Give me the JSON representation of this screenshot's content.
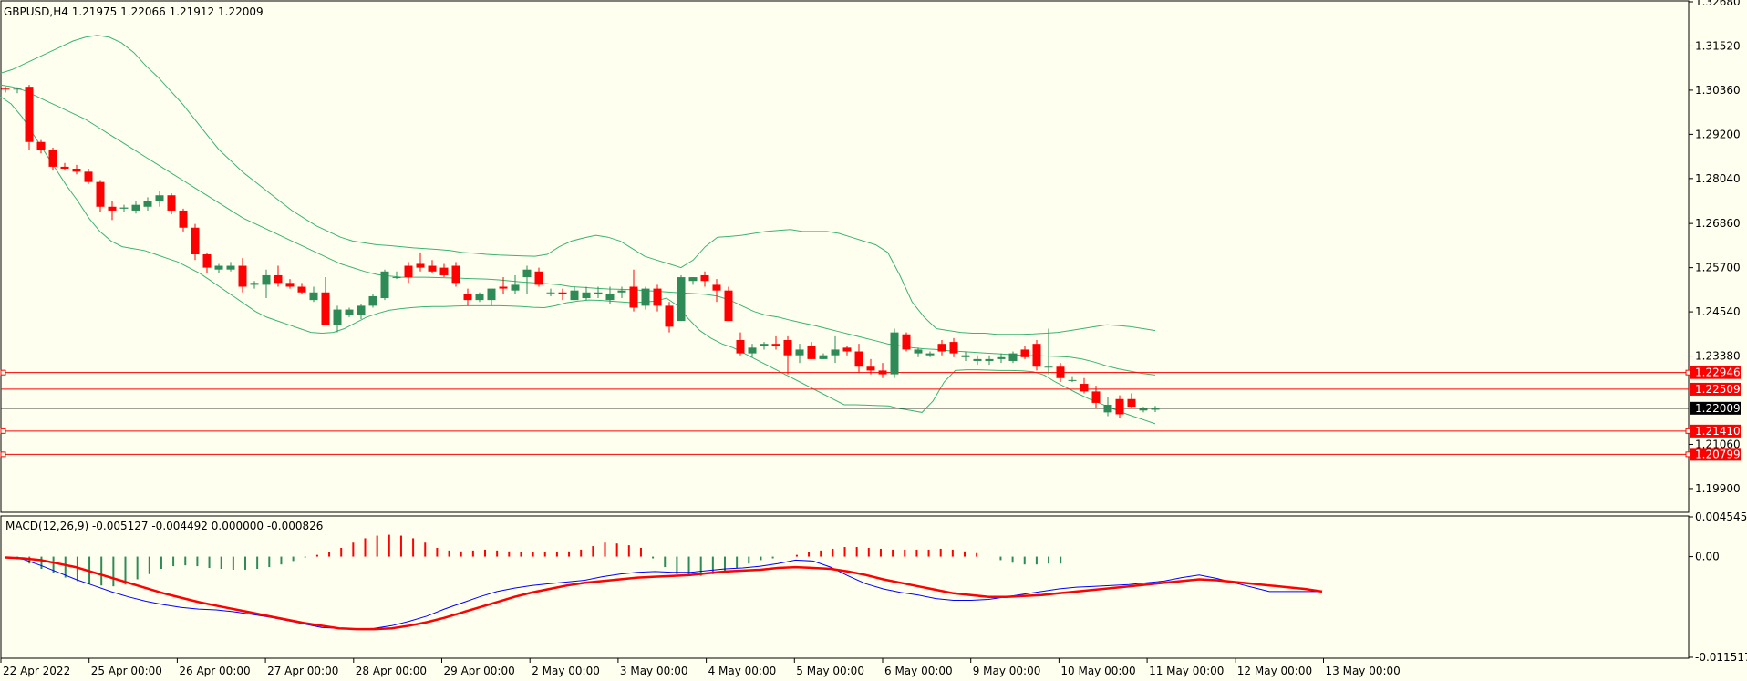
{
  "symbol_header": "GBPUSD,H4  1.21975 1.22066 1.21912 1.22009",
  "macd_header": "MACD(12,26,9) -0.005127 -0.004492 0.000000 -0.000826",
  "colors": {
    "background": "#fffff0",
    "bull_candle": "#2e8b57",
    "bear_candle": "#ff0000",
    "bollinger": "#3cb371",
    "level_line": "#ff0000",
    "current_price_line": "#000000",
    "macd_main": "#0000ff",
    "macd_signal": "#ff0000"
  },
  "chart_data": [
    {
      "type": "candlestick",
      "title": "GBPUSD,H4",
      "ylim": [
        1.193,
        1.3268
      ],
      "y_ticks": [
        "1.32680",
        "1.31520",
        "1.30360",
        "1.29200",
        "1.28040",
        "1.26860",
        "1.25700",
        "1.24540",
        "1.23380",
        "1.21060",
        "1.19900"
      ],
      "x_tick_labels": [
        "22 Apr 2022",
        "25 Apr 00:00",
        "26 Apr 00:00",
        "27 Apr 00:00",
        "28 Apr 00:00",
        "29 Apr 00:00",
        "2 May 00:00",
        "3 May 00:00",
        "4 May 00:00",
        "5 May 00:00",
        "6 May 00:00",
        "9 May 00:00",
        "10 May 00:00",
        "11 May 00:00",
        "12 May 00:00",
        "13 May 00:00"
      ],
      "candles": [
        [
          1.304,
          1.3045,
          1.303,
          1.3038
        ],
        [
          1.3038,
          1.3044,
          1.3028,
          1.304
        ],
        [
          1.3045,
          1.305,
          1.288,
          1.29
        ],
        [
          1.29,
          1.2905,
          1.287,
          1.288
        ],
        [
          1.288,
          1.2885,
          1.2825,
          1.2835
        ],
        [
          1.2835,
          1.2845,
          1.2825,
          1.283
        ],
        [
          1.283,
          1.284,
          1.2815,
          1.2822
        ],
        [
          1.2822,
          1.283,
          1.279,
          1.2795
        ],
        [
          1.2795,
          1.28,
          1.2715,
          1.273
        ],
        [
          1.273,
          1.2745,
          1.2695,
          1.272
        ],
        [
          1.2725,
          1.2735,
          1.2715,
          1.2728
        ],
        [
          1.272,
          1.2745,
          1.2712,
          1.2735
        ],
        [
          1.273,
          1.2755,
          1.272,
          1.2745
        ],
        [
          1.2745,
          1.277,
          1.273,
          1.276
        ],
        [
          1.276,
          1.2765,
          1.271,
          1.272
        ],
        [
          1.272,
          1.2725,
          1.2665,
          1.2675
        ],
        [
          1.2675,
          1.2685,
          1.259,
          1.2605
        ],
        [
          1.2605,
          1.261,
          1.2555,
          1.257
        ],
        [
          1.2565,
          1.258,
          1.2555,
          1.2575
        ],
        [
          1.2565,
          1.2585,
          1.256,
          1.2575
        ],
        [
          1.2575,
          1.2595,
          1.2505,
          1.252
        ],
        [
          1.2525,
          1.2535,
          1.2515,
          1.253
        ],
        [
          1.2525,
          1.2565,
          1.249,
          1.255
        ],
        [
          1.255,
          1.2575,
          1.252,
          1.253
        ],
        [
          1.253,
          1.254,
          1.2515,
          1.252
        ],
        [
          1.252,
          1.253,
          1.25,
          1.2505
        ],
        [
          1.2485,
          1.252,
          1.248,
          1.2505
        ],
        [
          1.2505,
          1.2545,
          1.2475,
          1.242
        ],
        [
          1.242,
          1.247,
          1.24,
          1.246
        ],
        [
          1.2445,
          1.2465,
          1.244,
          1.246
        ],
        [
          1.2445,
          1.2475,
          1.2435,
          1.247
        ],
        [
          1.247,
          1.25,
          1.2465,
          1.2495
        ],
        [
          1.249,
          1.2565,
          1.2485,
          1.256
        ],
        [
          1.2545,
          1.256,
          1.254,
          1.2545
        ],
        [
          1.2575,
          1.2585,
          1.253,
          1.2545
        ],
        [
          1.258,
          1.261,
          1.256,
          1.257
        ],
        [
          1.2575,
          1.259,
          1.2555,
          1.256
        ],
        [
          1.257,
          1.258,
          1.2545,
          1.255
        ],
        [
          1.2575,
          1.2585,
          1.252,
          1.253
        ],
        [
          1.25,
          1.2515,
          1.247,
          1.2485
        ],
        [
          1.2485,
          1.2505,
          1.248,
          1.25
        ],
        [
          1.2485,
          1.251,
          1.247,
          1.2515
        ],
        [
          1.252,
          1.2545,
          1.25,
          1.2515
        ],
        [
          1.251,
          1.255,
          1.25,
          1.2525
        ],
        [
          1.2545,
          1.2575,
          1.25,
          1.2565
        ],
        [
          1.256,
          1.257,
          1.252,
          1.2525
        ],
        [
          1.2505,
          1.2515,
          1.2495,
          1.2505
        ],
        [
          1.2505,
          1.2515,
          1.2485,
          1.25
        ],
        [
          1.2485,
          1.252,
          1.2485,
          1.251
        ],
        [
          1.249,
          1.252,
          1.2485,
          1.2505
        ],
        [
          1.25,
          1.252,
          1.249,
          1.2505
        ],
        [
          1.2485,
          1.252,
          1.2475,
          1.25
        ],
        [
          1.2505,
          1.252,
          1.249,
          1.251
        ],
        [
          1.252,
          1.2565,
          1.2455,
          1.2465
        ],
        [
          1.247,
          1.252,
          1.246,
          1.2515
        ],
        [
          1.2515,
          1.2525,
          1.2455,
          1.247
        ],
        [
          1.247,
          1.248,
          1.24,
          1.2415
        ],
        [
          1.243,
          1.255,
          1.243,
          1.2545
        ],
        [
          1.2535,
          1.2545,
          1.2525,
          1.2545
        ],
        [
          1.255,
          1.256,
          1.252,
          1.2535
        ],
        [
          1.2525,
          1.254,
          1.248,
          1.251
        ],
        [
          1.251,
          1.252,
          1.243,
          1.243
        ],
        [
          1.238,
          1.24,
          1.234,
          1.2345
        ],
        [
          1.2345,
          1.237,
          1.2335,
          1.236
        ],
        [
          1.2365,
          1.2375,
          1.2355,
          1.237
        ],
        [
          1.237,
          1.239,
          1.2355,
          1.2365
        ],
        [
          1.238,
          1.239,
          1.229,
          1.234
        ],
        [
          1.234,
          1.237,
          1.232,
          1.2355
        ],
        [
          1.2365,
          1.2375,
          1.233,
          1.233
        ],
        [
          1.233,
          1.2345,
          1.233,
          1.234
        ],
        [
          1.234,
          1.239,
          1.232,
          1.2355
        ],
        [
          1.236,
          1.2365,
          1.234,
          1.235
        ],
        [
          1.235,
          1.237,
          1.2295,
          1.231
        ],
        [
          1.231,
          1.233,
          1.229,
          1.23
        ],
        [
          1.23,
          1.232,
          1.228,
          1.229
        ],
        [
          1.229,
          1.241,
          1.228,
          1.24
        ],
        [
          1.2395,
          1.24,
          1.235,
          1.2355
        ],
        [
          1.2345,
          1.236,
          1.2335,
          1.2355
        ],
        [
          1.234,
          1.235,
          1.2335,
          1.2345
        ],
        [
          1.237,
          1.238,
          1.234,
          1.235
        ],
        [
          1.2375,
          1.2385,
          1.2335,
          1.2345
        ],
        [
          1.2335,
          1.235,
          1.2325,
          1.234
        ],
        [
          1.2325,
          1.234,
          1.2315,
          1.233
        ],
        [
          1.2325,
          1.234,
          1.2315,
          1.233
        ],
        [
          1.233,
          1.2345,
          1.232,
          1.2335
        ],
        [
          1.2325,
          1.235,
          1.232,
          1.2345
        ],
        [
          1.2355,
          1.2365,
          1.233,
          1.2335
        ],
        [
          1.237,
          1.238,
          1.23,
          1.231
        ],
        [
          1.231,
          1.241,
          1.229,
          1.231
        ],
        [
          1.231,
          1.232,
          1.227,
          1.228
        ],
        [
          1.2275,
          1.2285,
          1.227,
          1.2275
        ],
        [
          1.2265,
          1.228,
          1.224,
          1.2245
        ],
        [
          1.2245,
          1.226,
          1.22,
          1.2215
        ],
        [
          1.219,
          1.223,
          1.218,
          1.221
        ],
        [
          1.2225,
          1.2235,
          1.2175,
          1.2185
        ],
        [
          1.2225,
          1.224,
          1.22,
          1.2205
        ],
        [
          1.2195,
          1.2205,
          1.219,
          1.22
        ],
        [
          1.2197,
          1.2207,
          1.2191,
          1.2201
        ]
      ],
      "bollinger_upper": [
        1.308,
        1.309,
        1.3105,
        1.312,
        1.3135,
        1.315,
        1.3165,
        1.3175,
        1.318,
        1.3175,
        1.316,
        1.3135,
        1.31,
        1.307,
        1.3035,
        1.3,
        1.296,
        1.292,
        1.288,
        1.285,
        1.282,
        1.2795,
        1.277,
        1.2745,
        1.272,
        1.27,
        1.268,
        1.2665,
        1.265,
        1.264,
        1.2635,
        1.263,
        1.2628,
        1.2625,
        1.2622,
        1.262,
        1.2618,
        1.2615,
        1.261,
        1.2608,
        1.2605,
        1.2603,
        1.2602,
        1.2601,
        1.26,
        1.2605,
        1.2625,
        1.264,
        1.2648,
        1.2655,
        1.265,
        1.264,
        1.262,
        1.26,
        1.259,
        1.258,
        1.257,
        1.259,
        1.2625,
        1.265,
        1.2652,
        1.2655,
        1.266,
        1.2665,
        1.2668,
        1.267,
        1.2665,
        1.2665,
        1.2665,
        1.266,
        1.265,
        1.264,
        1.263,
        1.261,
        1.255,
        1.248,
        1.244,
        1.241,
        1.2405,
        1.24,
        1.2398,
        1.2398,
        1.2395,
        1.2395,
        1.2395,
        1.2396,
        1.2398,
        1.24,
        1.2405,
        1.241,
        1.2415,
        1.242,
        1.2418,
        1.2415,
        1.241,
        1.2405
      ],
      "bollinger_middle": [
        1.305,
        1.3045,
        1.3035,
        1.302,
        1.3005,
        1.299,
        1.2975,
        1.296,
        1.294,
        1.292,
        1.29,
        1.288,
        1.286,
        1.284,
        1.282,
        1.28,
        1.278,
        1.276,
        1.274,
        1.272,
        1.27,
        1.2685,
        1.267,
        1.2655,
        1.264,
        1.2625,
        1.261,
        1.2595,
        1.258,
        1.257,
        1.256,
        1.2552,
        1.2548,
        1.2545,
        1.2545,
        1.2545,
        1.2544,
        1.2543,
        1.2542,
        1.2541,
        1.254,
        1.2538,
        1.2535,
        1.2532,
        1.253,
        1.2528,
        1.2525,
        1.252,
        1.2518,
        1.2516,
        1.2514,
        1.2513,
        1.2512,
        1.251,
        1.2508,
        1.2506,
        1.2504,
        1.2502,
        1.25,
        1.2495,
        1.2485,
        1.247,
        1.2455,
        1.2445,
        1.244,
        1.2432,
        1.2425,
        1.2418,
        1.241,
        1.2402,
        1.2394,
        1.2386,
        1.2378,
        1.237,
        1.2365,
        1.236,
        1.2357,
        1.2355,
        1.2352,
        1.235,
        1.2348,
        1.2346,
        1.2344,
        1.2342,
        1.234,
        1.2339,
        1.2338,
        1.2337,
        1.2335,
        1.233,
        1.2322,
        1.2312,
        1.2304,
        1.2298,
        1.2292,
        1.2288
      ],
      "bollinger_lower": [
        1.302,
        1.3,
        1.2965,
        1.292,
        1.2875,
        1.283,
        1.2785,
        1.2745,
        1.27,
        1.2665,
        1.264,
        1.2625,
        1.262,
        1.2615,
        1.2605,
        1.2595,
        1.2585,
        1.257,
        1.2555,
        1.2535,
        1.2515,
        1.2495,
        1.2475,
        1.2455,
        1.244,
        1.243,
        1.242,
        1.241,
        1.24,
        1.2398,
        1.24,
        1.241,
        1.2425,
        1.244,
        1.245,
        1.2458,
        1.2462,
        1.2465,
        1.2467,
        1.2468,
        1.2468,
        1.2469,
        1.247,
        1.247,
        1.247,
        1.247,
        1.2469,
        1.2468,
        1.2466,
        1.2465,
        1.247,
        1.2478,
        1.2482,
        1.2485,
        1.2484,
        1.2482,
        1.248,
        1.2478,
        1.248,
        1.2482,
        1.249,
        1.247,
        1.2435,
        1.2405,
        1.2385,
        1.237,
        1.236,
        1.2345,
        1.233,
        1.2315,
        1.23,
        1.2285,
        1.227,
        1.2255,
        1.224,
        1.2225,
        1.221,
        1.221,
        1.2209,
        1.2208,
        1.2207,
        1.22,
        1.2195,
        1.219,
        1.222,
        1.227,
        1.23,
        1.2302,
        1.2302,
        1.2301,
        1.23,
        1.23,
        1.2299,
        1.2297,
        1.2288,
        1.227,
        1.2255,
        1.224,
        1.2226,
        1.2214,
        1.2202,
        1.219,
        1.218,
        1.217,
        1.216
      ],
      "level_lines": [
        {
          "price": 1.22946,
          "label": "1.22946",
          "marker": true
        },
        {
          "price": 1.22509,
          "label": "1.22509",
          "marker": false
        },
        {
          "price": 1.2141,
          "label": "1.21410",
          "marker": true
        },
        {
          "price": 1.20799,
          "label": "1.20799",
          "marker": true
        }
      ],
      "current_price": {
        "price": 1.22009,
        "label": "1.22009"
      }
    },
    {
      "type": "macd",
      "title": "MACD(12,26,9)",
      "ylim": [
        -0.01152,
        0.00465
      ],
      "y_ticks": [
        "0.004545",
        "0.00",
        "-0.011517"
      ],
      "histogram": [
        -0.0001,
        -0.0003,
        -0.0008,
        -0.0014,
        -0.0019,
        -0.0024,
        -0.0028,
        -0.0031,
        -0.0033,
        -0.0034,
        -0.0032,
        -0.0026,
        -0.002,
        -0.0014,
        -0.0011,
        -0.001,
        -0.0011,
        -0.0013,
        -0.0014,
        -0.0015,
        -0.0015,
        -0.0014,
        -0.0012,
        -0.0009,
        -0.0005,
        -0.0001,
        0.0002,
        0.0005,
        0.001,
        0.0016,
        0.0021,
        0.0024,
        0.0025,
        0.0024,
        0.0021,
        0.0016,
        0.001,
        0.0007,
        0.0006,
        0.0007,
        0.0008,
        0.0007,
        0.0006,
        0.0005,
        0.0005,
        0.0005,
        0.0005,
        0.0006,
        0.0008,
        0.0012,
        0.0016,
        0.0015,
        0.0013,
        0.001,
        -0.0002,
        -0.0012,
        -0.002,
        -0.0022,
        -0.0022,
        -0.002,
        -0.0018,
        -0.0013,
        -0.0008,
        -0.0004,
        -0.0002,
        0.0,
        0.0002,
        0.0005,
        0.0007,
        0.0009,
        0.0011,
        0.0011,
        0.001,
        0.0009,
        0.0008,
        0.0008,
        0.0008,
        0.0008,
        0.0009,
        0.0008,
        0.0006,
        0.0004,
        0.0,
        -0.0004,
        -0.0007,
        -0.0009,
        -0.0009,
        -0.0008,
        -0.0008
      ],
      "main": [
        -0.0001,
        -0.0003,
        -0.001,
        -0.0018,
        -0.0026,
        -0.0033,
        -0.004,
        -0.0046,
        -0.0051,
        -0.0055,
        -0.0058,
        -0.006,
        -0.0061,
        -0.0063,
        -0.0066,
        -0.0069,
        -0.0073,
        -0.0077,
        -0.0081,
        -0.0082,
        -0.0083,
        -0.0082,
        -0.0079,
        -0.0074,
        -0.0068,
        -0.006,
        -0.0053,
        -0.0046,
        -0.004,
        -0.0036,
        -0.0033,
        -0.0031,
        -0.0029,
        -0.0027,
        -0.0023,
        -0.002,
        -0.0018,
        -0.0017,
        -0.0018,
        -0.0018,
        -0.0016,
        -0.0014,
        -0.0013,
        -0.0011,
        -0.0008,
        -0.0004,
        -0.0005,
        -0.0012,
        -0.0022,
        -0.0031,
        -0.0037,
        -0.0041,
        -0.0044,
        -0.0048,
        -0.005,
        -0.005,
        -0.0049,
        -0.0046,
        -0.0043,
        -0.004,
        -0.0037,
        -0.0035,
        -0.0034,
        -0.0033,
        -0.0032,
        -0.003,
        -0.0028,
        -0.0024,
        -0.0021,
        -0.0025,
        -0.003,
        -0.0035,
        -0.004,
        -0.004,
        -0.004,
        -0.004
      ],
      "signal": [
        -0.0001,
        -0.0002,
        -0.0004,
        -0.0008,
        -0.0012,
        -0.0018,
        -0.0024,
        -0.003,
        -0.0036,
        -0.0042,
        -0.0047,
        -0.0052,
        -0.0056,
        -0.006,
        -0.0064,
        -0.0068,
        -0.0072,
        -0.0076,
        -0.0079,
        -0.0082,
        -0.0083,
        -0.0083,
        -0.0082,
        -0.0079,
        -0.0075,
        -0.007,
        -0.0064,
        -0.0058,
        -0.0052,
        -0.0046,
        -0.0041,
        -0.0037,
        -0.0033,
        -0.003,
        -0.0028,
        -0.0026,
        -0.0024,
        -0.0023,
        -0.0022,
        -0.0021,
        -0.0019,
        -0.0017,
        -0.0016,
        -0.0015,
        -0.0013,
        -0.0012,
        -0.0013,
        -0.0014,
        -0.0017,
        -0.0021,
        -0.0026,
        -0.003,
        -0.0034,
        -0.0038,
        -0.0042,
        -0.0044,
        -0.0046,
        -0.0046,
        -0.0045,
        -0.0044,
        -0.0042,
        -0.004,
        -0.0038,
        -0.0036,
        -0.0034,
        -0.0032,
        -0.003,
        -0.0028,
        -0.0026,
        -0.0027,
        -0.0029,
        -0.0031,
        -0.0033,
        -0.0035,
        -0.0037,
        -0.004
      ]
    }
  ]
}
